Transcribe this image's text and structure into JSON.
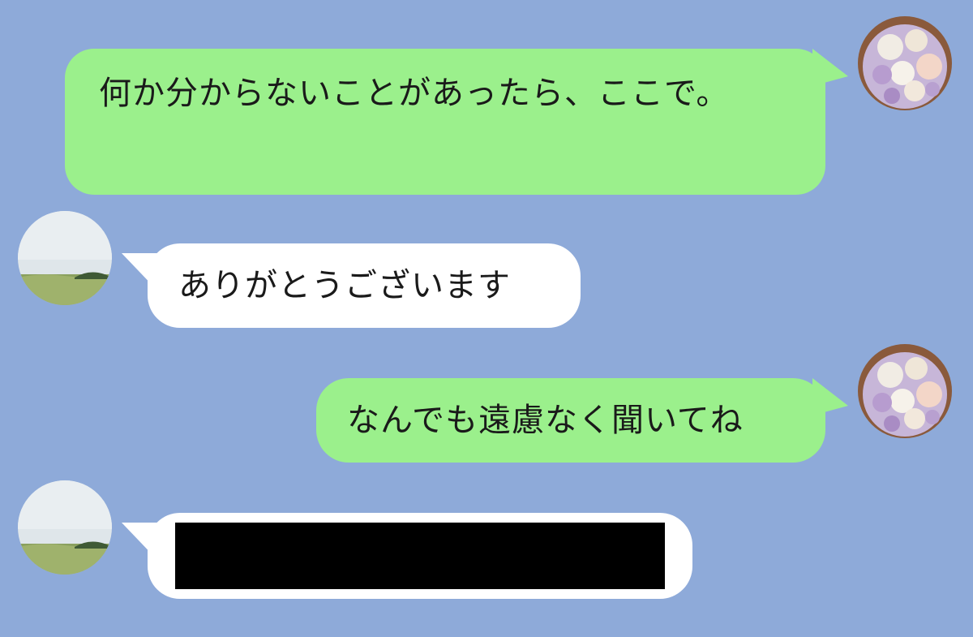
{
  "chat": {
    "background_color": "#8eaad9",
    "sent_bubble_color": "#9bf08c",
    "received_bubble_color": "#ffffff",
    "messages": [
      {
        "side": "sent",
        "text": "何か分からないことがあったら、ここで。"
      },
      {
        "side": "received",
        "text": "ありがとうございます"
      },
      {
        "side": "sent",
        "text": "なんでも遠慮なく聞いてね"
      },
      {
        "side": "received",
        "text": "",
        "redacted": true
      }
    ]
  },
  "avatars": {
    "sender": "flower-bouquet-avatar",
    "receiver": "landscape-avatar"
  }
}
